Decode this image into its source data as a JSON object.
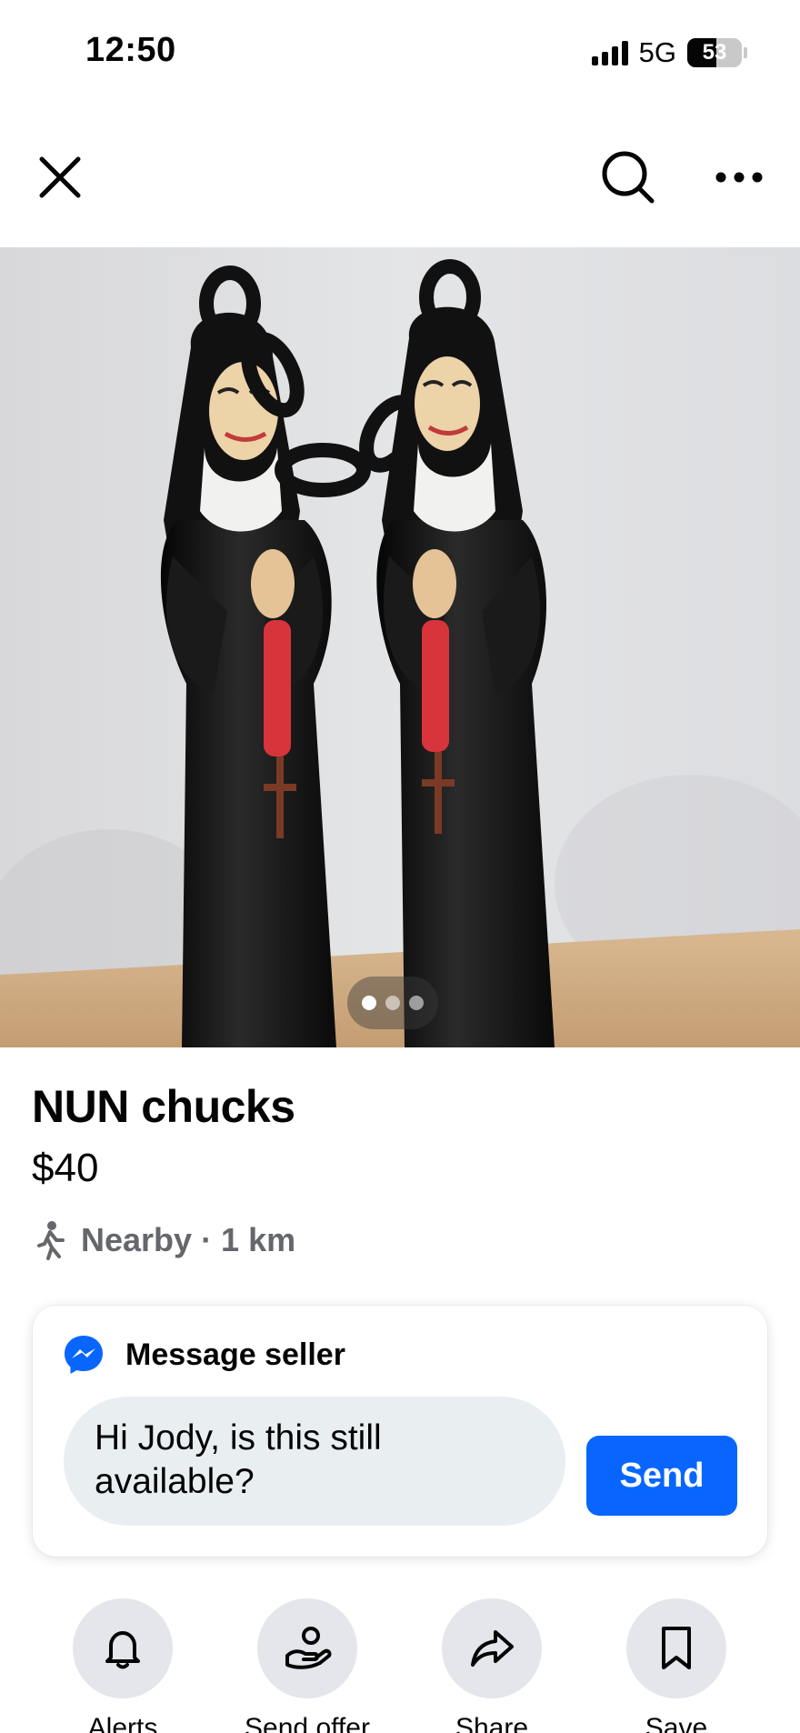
{
  "status_bar": {
    "time": "12:50",
    "network": "5G",
    "battery": "53",
    "battery_level_percent": 53
  },
  "nav": {
    "icons": [
      "close-icon",
      "search-icon",
      "more-icon"
    ]
  },
  "photo": {
    "carousel_total": 3,
    "carousel_active": 1,
    "colors": {
      "wall": "#dedfe2",
      "table": "#cfac82",
      "robe": "#111111",
      "rosary": "#d8343c"
    }
  },
  "listing": {
    "title": "NUN chucks",
    "price": "$40",
    "location": "Nearby · 1 km"
  },
  "message": {
    "header": "Message seller",
    "draft": "Hi Jody, is this still available?",
    "send_label": "Send"
  },
  "actions": [
    {
      "label": "Alerts",
      "icon": "bell-icon"
    },
    {
      "label": "Send offer",
      "icon": "offer-icon"
    },
    {
      "label": "Share",
      "icon": "share-icon"
    },
    {
      "label": "Save",
      "icon": "bookmark-icon"
    }
  ],
  "colors": {
    "accent": "#0866ff",
    "secondary_text": "#65676b",
    "input_bg": "#e9eef1",
    "circle_bg": "#e4e6eb"
  }
}
